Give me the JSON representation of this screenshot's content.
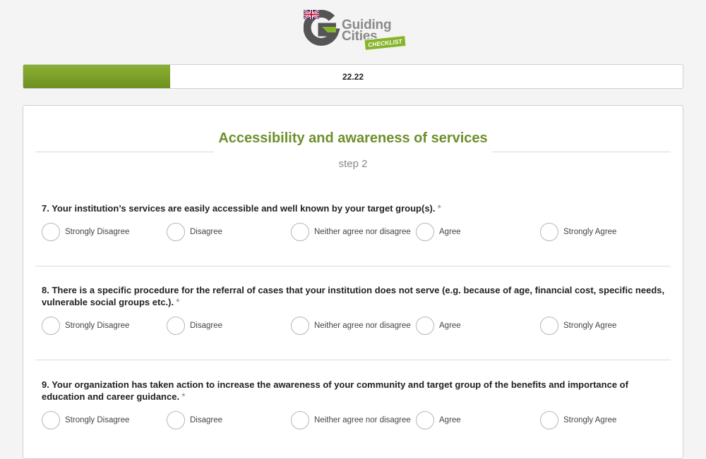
{
  "logo": {
    "line1": "Guiding",
    "line2": "Cities",
    "badge": "CHECKLIST",
    "language_flag": "uk-flag-icon"
  },
  "progress": {
    "value": 22.22,
    "label": "22.22"
  },
  "section": {
    "title": "Accessibility and awareness of services",
    "step": "step 2"
  },
  "options": [
    "Strongly Disagree",
    "Disagree",
    "Neither agree nor disagree",
    "Agree",
    "Strongly Agree"
  ],
  "questions": [
    {
      "text": "7. Your institution’s services are easily accessible and well known by your target group(s).",
      "required_mark": "*"
    },
    {
      "text": "8. There is a specific procedure for the referral of cases that your institution does not serve (e.g. because of age, financial cost, specific needs, vulnerable social groups etc.).",
      "required_mark": "*"
    },
    {
      "text": "9. Your organization has taken action to increase the awareness of your community and target group of the benefits and importance of education and career guidance.",
      "required_mark": "*"
    }
  ],
  "colors": {
    "accent": "#6e8f2a",
    "progress_fill": "#7da02a",
    "logo_gray": "#8a8a8a"
  }
}
